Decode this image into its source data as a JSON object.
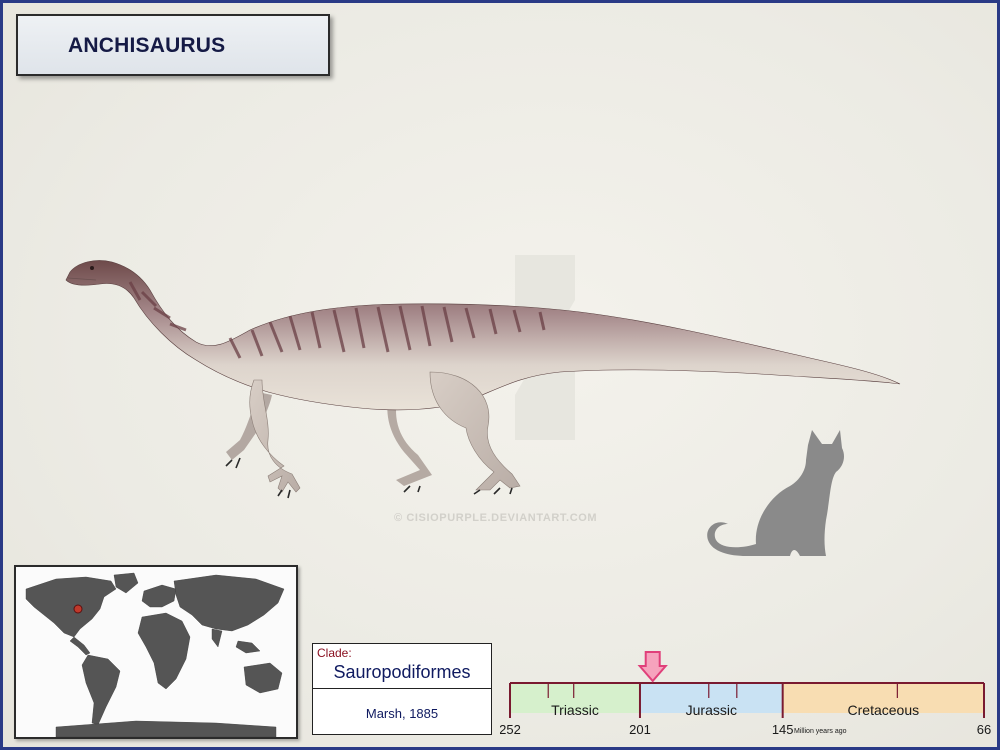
{
  "title": "ANCHISAURUS",
  "watermark": "© CISIOPURPLE.DEVIANTART.COM",
  "clade": {
    "label": "Clade:",
    "name": "Sauropodiformes",
    "author": "Marsh, 1885"
  },
  "timeline": {
    "periods": [
      {
        "name": "Triassic",
        "start": 252,
        "end": 201,
        "color": "#d6f0cc"
      },
      {
        "name": "Jurassic",
        "start": 201,
        "end": 145,
        "color": "#c9e2f3"
      },
      {
        "name": "Cretaceous",
        "start": 145,
        "end": 66,
        "color": "#f8ddb2"
      }
    ],
    "ticks": [
      "252",
      "201",
      "145",
      "66"
    ],
    "unit_label": "Million years ago",
    "marker_value": 196,
    "accent": "#e0407a"
  },
  "map": {
    "location_marker": "north-america-east",
    "marker_color": "#c0392b"
  },
  "colors": {
    "frame": "#2a3a86",
    "title_text": "#151a45",
    "silhouette": "#8a8a8a"
  }
}
